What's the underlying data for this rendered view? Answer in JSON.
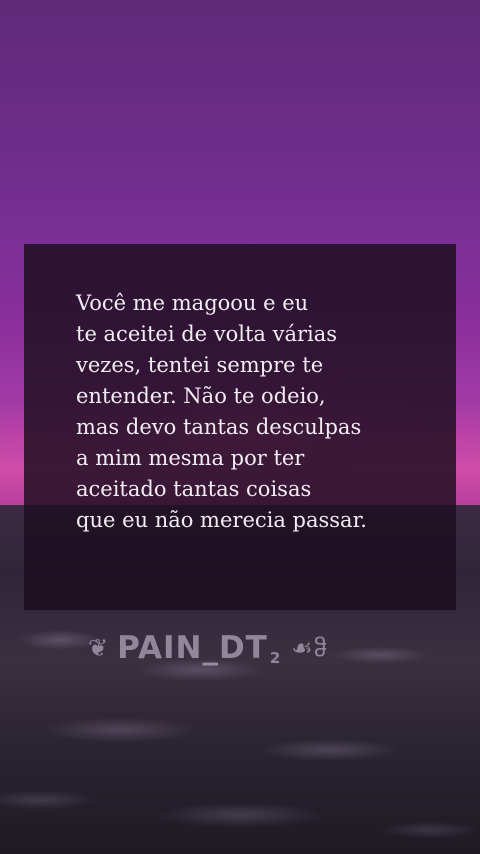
{
  "quote": {
    "lines": [
      "Você me magoou e eu",
      "te aceitei de volta várias",
      "vezes, tentei sempre te",
      "entender. Não te odeio,",
      "mas devo tantas desculpas",
      "a mim mesma por ter",
      "aceitado tantas coisas",
      "que eu não merecia passar."
    ]
  },
  "watermark": {
    "text": "PAIN_DT",
    "subscript": "2",
    "left_icon": "❦",
    "right_icon": "☙ჵ",
    "left_icon_name": "heart-flourish-icon",
    "right_icon_name": "ornament-icon"
  },
  "background": {
    "sky_color": "#7a2f95",
    "glow_color": "#d04ca8",
    "sea_color": "#2f2638"
  }
}
